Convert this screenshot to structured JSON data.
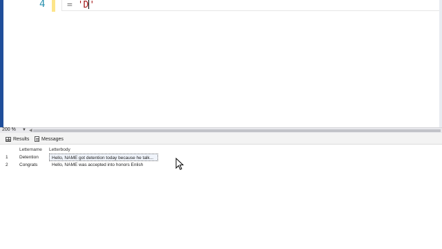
{
  "editor": {
    "line_number": "4",
    "code_operator": "= ",
    "code_string": "'D'"
  },
  "status": {
    "zoom": "200 %",
    "zoom_dropdown_icon": "triangle-down"
  },
  "results_tabs": [
    {
      "label": "Results",
      "icon": "grid-icon"
    },
    {
      "label": "Messages",
      "icon": "message-icon"
    }
  ],
  "results_grid": {
    "columns": [
      "Lettername",
      "Letterbody"
    ],
    "rows": [
      {
        "num": "1",
        "lettername": "Detention",
        "letterbody": "Hello, NAME got detention today because he talk..."
      },
      {
        "num": "2",
        "lettername": "Congrats",
        "letterbody": "Hello, NAME was accepted into honors Enlish"
      }
    ]
  },
  "colors": {
    "line_number": "#2b91af",
    "string_literal": "#a31515",
    "operator": "#808080",
    "change_marker": "#fde58a",
    "window_edge": "#1f4e9a"
  }
}
